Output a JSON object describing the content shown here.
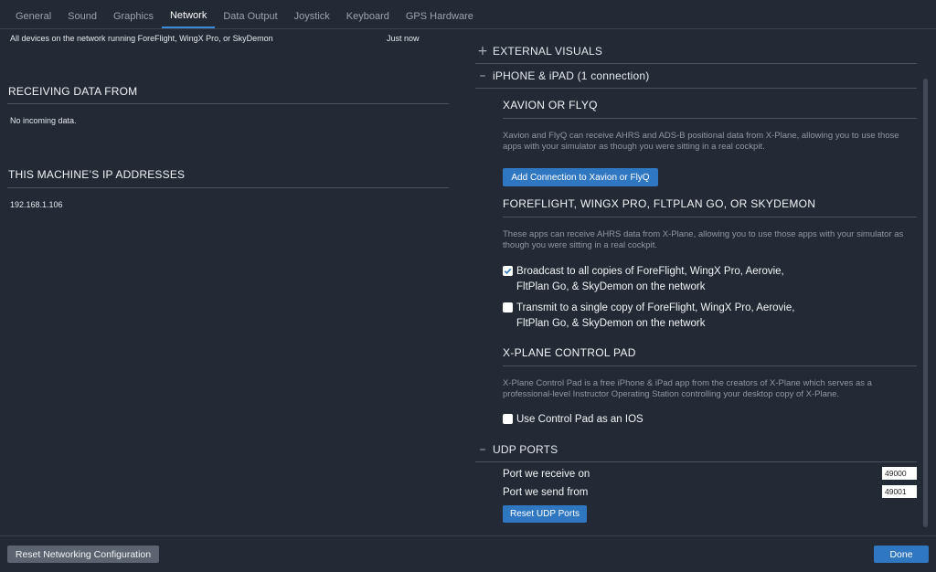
{
  "tabs": [
    "General",
    "Sound",
    "Graphics",
    "Network",
    "Data Output",
    "Joystick",
    "Keyboard",
    "GPS Hardware"
  ],
  "active_tab": "Network",
  "left": {
    "device_row": {
      "label": "All devices on the network running ForeFlight, WingX Pro, or SkyDemon",
      "time": "Just now"
    },
    "receiving": {
      "title": "RECEIVING DATA FROM",
      "text": "No incoming data."
    },
    "ip": {
      "title": "THIS MACHINE’S IP ADDRESSES",
      "address": "192.168.1.106"
    }
  },
  "right": {
    "external_visuals": "EXTERNAL VISUALS",
    "iphone_ipad": "iPHONE & iPAD (1 connection)",
    "xavion": {
      "title": "XAVION OR FLYQ",
      "desc": "Xavion and FlyQ can receive AHRS and ADS-B positional data from X-Plane, allowing you to use those apps with your simulator as though you were sitting in a real cockpit.",
      "button": "Add Connection to Xavion or FlyQ"
    },
    "foreflight": {
      "title": "FOREFLIGHT, WINGX PRO, FLTPLAN GO, OR SKYDEMON",
      "desc": "These apps can receive AHRS data from X-Plane, allowing you to use those apps with your simulator as though you were sitting in a real cockpit.",
      "broadcast": "Broadcast to all copies of ForeFlight, WingX Pro, Aerovie, FltPlan Go, & SkyDemon on the network",
      "broadcast_checked": true,
      "transmit": "Transmit to a single copy of ForeFlight, WingX Pro, Aerovie, FltPlan Go, & SkyDemon on the network",
      "transmit_checked": false
    },
    "control_pad": {
      "title": "X-PLANE CONTROL PAD",
      "desc": "X-Plane Control Pad is a free iPhone & iPad app from the creators of X-Plane which serves as a professional-level Instructor Operating Station controlling your desktop copy of X-Plane.",
      "checkbox": "Use Control Pad as an IOS",
      "checked": false
    },
    "udp": {
      "title": "UDP PORTS",
      "receive_label": "Port we receive on",
      "receive_value": "49000",
      "send_label": "Port we send from",
      "send_value": "49001",
      "reset_button": "Reset UDP Ports"
    }
  },
  "footer": {
    "reset_config": "Reset Networking Configuration",
    "done": "Done"
  }
}
